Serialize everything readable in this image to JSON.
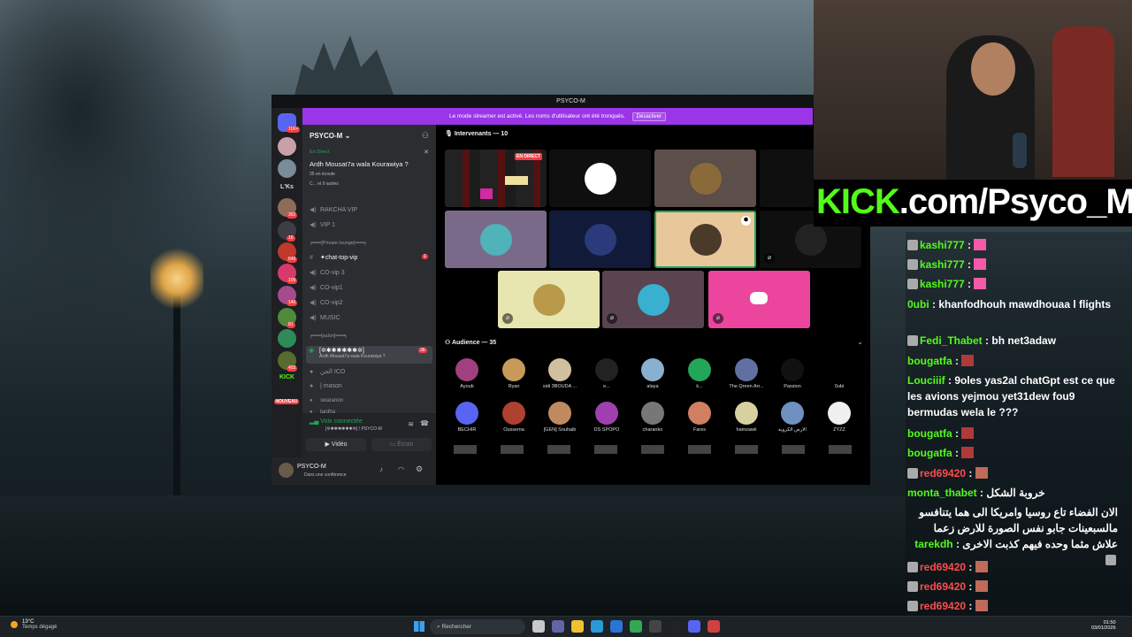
{
  "discord": {
    "window_title": "PSYCO-M",
    "banner_text": "Le mode streamer est activé. Les noms d'utilisateur ont été tronqués.",
    "banner_button": "Désactiver",
    "server_name": "PSYCO-M",
    "guild_badges": [
      "11K+",
      "1",
      "362",
      "16",
      "649",
      "109",
      "140",
      "81",
      "403"
    ],
    "guild_labels": [
      "L'Ks",
      "KICK",
      "NOUVEAU"
    ],
    "stage": {
      "live_label": "En Direct",
      "title": "Ardh Mousat7a wala Kourawiya ?",
      "meta": "35 en écoute",
      "meta2": "C... et 9 autres"
    },
    "channels": [
      {
        "name": "RAKCHA VIP",
        "type": "voice"
      },
      {
        "name": "VIP 1",
        "type": "voice"
      },
      {
        "name": "┍━━━[Private lounge]━━━┑",
        "type": "category"
      },
      {
        "name": "✦chat-top-vip",
        "type": "text",
        "badge": "1"
      },
      {
        "name": "CO-vip 3",
        "type": "voice"
      },
      {
        "name": "CO-vip1",
        "type": "voice"
      },
      {
        "name": "CO-vip2",
        "type": "voice"
      },
      {
        "name": "MUSIC",
        "type": "voice"
      },
      {
        "name": "┍━━━[salon]━━━┑",
        "type": "category"
      },
      {
        "name": "[✲✱✱✱✱✱✱✲]",
        "type": "stage",
        "badge": "36",
        "sub": "Ardh Mousat7a wala Kourawiya ?"
      },
      {
        "name": "ﺍﻟﺠﻦ ICO",
        "type": "voice"
      },
      {
        "name": "| mason",
        "type": "voice"
      },
      {
        "name": "swaranon",
        "type": "user"
      },
      {
        "name": "tardha",
        "type": "user"
      }
    ],
    "voice_connected": "Voix connectée",
    "voice_sub": "[✲✱✱✱✱✱✱✲] / PSYCO-M",
    "video_label": "Vidéo",
    "screen_label": "Écran",
    "user": {
      "name": "PSYCO-M",
      "status": "Dans une conférence"
    },
    "speakers_header": "Intervenants — 10",
    "live_badge": "EN DIRECT",
    "audience_header": "Audience — 35",
    "audience": [
      "Ayoub",
      "Ryan",
      "sidi 3BOUDA ...",
      "e...",
      "alaya",
      "k...",
      "The Qreen Arr...",
      "Passion",
      "0ubi",
      "BECHIR",
      "Oussema",
      "[GEN] Souhaib",
      "DS SPOPO",
      "charanko",
      "Fares",
      "hamzawii",
      "الأرض الكروية",
      "ZYZZ"
    ]
  },
  "kick_url": {
    "brand": "KICK",
    "rest": ".com/Psyco_M"
  },
  "chat": [
    {
      "user": "kashi777",
      "text": ""
    },
    {
      "user": "kashi777",
      "text": ""
    },
    {
      "user": "kashi777",
      "text": ""
    },
    {
      "user": "0ubi",
      "text": "khanfodhouh mawdhouaa l flights"
    },
    {
      "user": "Fedi_Thabet",
      "text": "bh net3adaw"
    },
    {
      "user": "bougatfa",
      "text": ""
    },
    {
      "user": "Louciiif",
      "text": "9oles yas2al chatGpt est ce que les avions yejmou yet31dew fou9 bermudas wela le ???"
    },
    {
      "user": "bougatfa",
      "text": ""
    },
    {
      "user": "bougatfa",
      "text": ""
    },
    {
      "user": "red69420",
      "text": ""
    },
    {
      "user": "monta_thabet",
      "text": "خروبة الشكل"
    },
    {
      "user": "tarekdh",
      "text": "الان الفضاء تاع روسيا وامريكا الى هما يتنافسو مالسبعينات جابو نفس الصورة للارض زعما علاش مثما وحده فيهم كذبت الاخرى"
    },
    {
      "user": "red69420",
      "text": ""
    },
    {
      "user": "red69420",
      "text": ""
    },
    {
      "user": "red69420",
      "text": ""
    },
    {
      "user": "red69420",
      "text": ""
    }
  ],
  "taskbar": {
    "weather_temp": "13°C",
    "weather_desc": "Temps dégagé",
    "search_placeholder": "Rechercher",
    "time": "01:50",
    "date": "03/01/2026"
  }
}
